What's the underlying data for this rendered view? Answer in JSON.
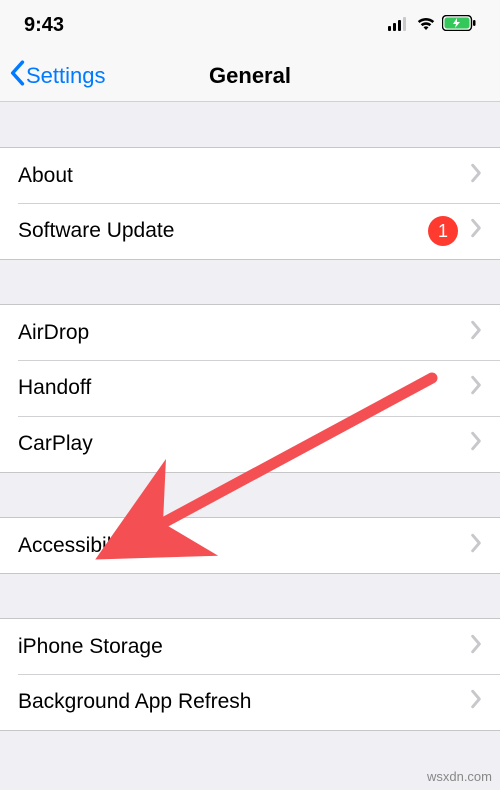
{
  "statusBar": {
    "time": "9:43"
  },
  "nav": {
    "back": "Settings",
    "title": "General"
  },
  "groups": [
    {
      "items": [
        {
          "key": "about",
          "label": "About",
          "badge": null
        },
        {
          "key": "software-update",
          "label": "Software Update",
          "badge": "1"
        }
      ]
    },
    {
      "items": [
        {
          "key": "airdrop",
          "label": "AirDrop",
          "badge": null
        },
        {
          "key": "handoff",
          "label": "Handoff",
          "badge": null
        },
        {
          "key": "carplay",
          "label": "CarPlay",
          "badge": null
        }
      ]
    },
    {
      "items": [
        {
          "key": "accessibility",
          "label": "Accessibility",
          "badge": null
        }
      ]
    },
    {
      "items": [
        {
          "key": "iphone-storage",
          "label": "iPhone Storage",
          "badge": null
        },
        {
          "key": "background-app-refresh",
          "label": "Background App Refresh",
          "badge": null
        }
      ]
    }
  ],
  "annotation": {
    "arrow_color": "#f45054",
    "from": "handoff",
    "to": "accessibility"
  },
  "watermark": "wsxdn.com"
}
